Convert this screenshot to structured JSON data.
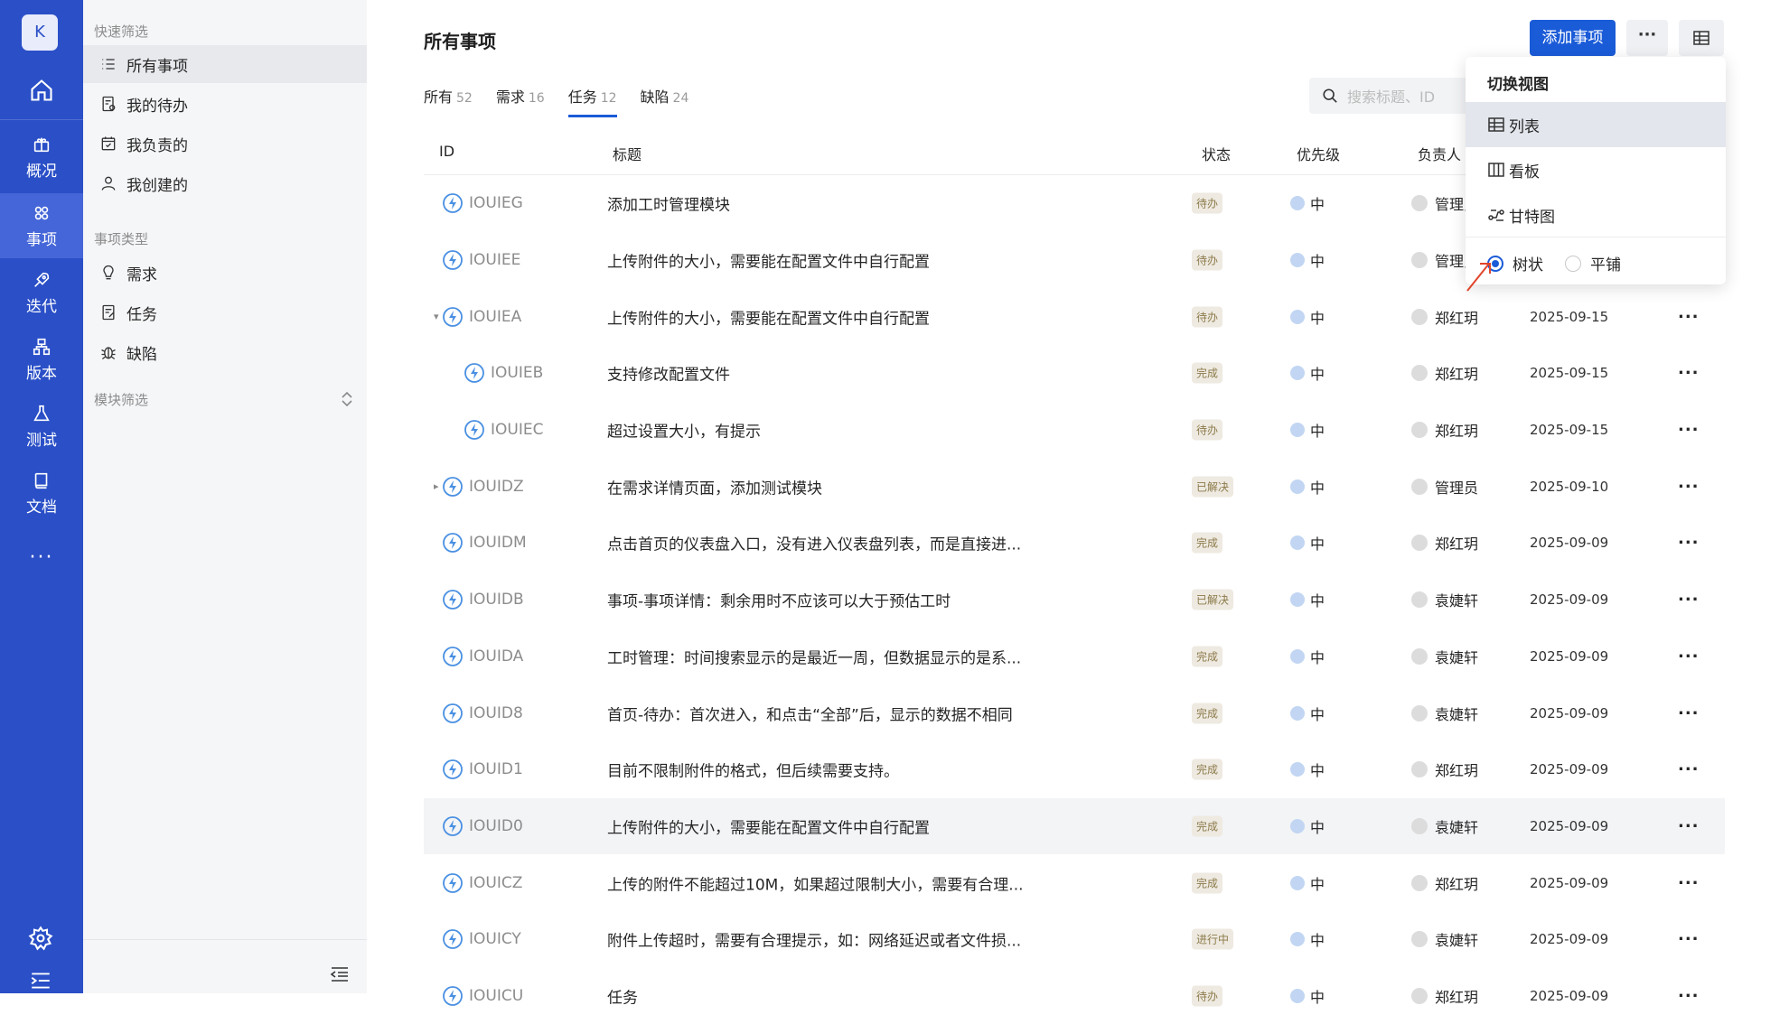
{
  "rail": {
    "avatar_letter": "K",
    "items": [
      {
        "label": "概况"
      },
      {
        "label": "事项"
      },
      {
        "label": "迭代"
      },
      {
        "label": "版本"
      },
      {
        "label": "测试"
      },
      {
        "label": "文档"
      }
    ],
    "more": "···"
  },
  "sidebar": {
    "quick_filter_title": "快速筛选",
    "quick_filters": [
      {
        "label": "所有事项",
        "icon": "list-icon"
      },
      {
        "label": "我的待办",
        "icon": "todo-icon"
      },
      {
        "label": "我负责的",
        "icon": "calendar-check-icon"
      },
      {
        "label": "我创建的",
        "icon": "user-icon"
      }
    ],
    "type_title": "事项类型",
    "types": [
      {
        "label": "需求",
        "icon": "bulb-icon"
      },
      {
        "label": "任务",
        "icon": "task-icon"
      },
      {
        "label": "缺陷",
        "icon": "bug-icon"
      }
    ],
    "module_title": "模块筛选"
  },
  "header": {
    "title": "所有事项",
    "add_button": "添加事项",
    "more_button": "···"
  },
  "tabs": [
    {
      "label": "所有",
      "count": "52"
    },
    {
      "label": "需求",
      "count": "16"
    },
    {
      "label": "任务",
      "count": "12"
    },
    {
      "label": "缺陷",
      "count": "24"
    }
  ],
  "search": {
    "placeholder": "搜索标题、ID"
  },
  "table": {
    "columns": [
      "ID",
      "标题",
      "状态",
      "优先级",
      "负责人"
    ],
    "rows": [
      {
        "id": "IOUIEG",
        "title": "添加工时管理模块",
        "status": "待办",
        "priority": "中",
        "owner": "管理员",
        "date": ""
      },
      {
        "id": "IOUIEE",
        "title": "上传附件的大小，需要能在配置文件中自行配置",
        "status": "待办",
        "priority": "中",
        "owner": "管理员",
        "date": ""
      },
      {
        "id": "IOUIEA",
        "title": "上传附件的大小，需要能在配置文件中自行配置",
        "status": "待办",
        "priority": "中",
        "owner": "郑红玥",
        "date": "2025-09-15"
      },
      {
        "id": "IOUIEB",
        "title": "支持修改配置文件",
        "status": "完成",
        "priority": "中",
        "owner": "郑红玥",
        "date": "2025-09-15"
      },
      {
        "id": "IOUIEC",
        "title": "超过设置大小，有提示",
        "status": "待办",
        "priority": "中",
        "owner": "郑红玥",
        "date": "2025-09-15"
      },
      {
        "id": "IOUIDZ",
        "title": "在需求详情页面，添加测试模块",
        "status": "已解决",
        "priority": "中",
        "owner": "管理员",
        "date": "2025-09-10"
      },
      {
        "id": "IOUIDM",
        "title": "点击首页的仪表盘入口，没有进入仪表盘列表，而是直接进...",
        "status": "完成",
        "priority": "中",
        "owner": "郑红玥",
        "date": "2025-09-09"
      },
      {
        "id": "IOUIDB",
        "title": "事项-事项详情：剩余用时不应该可以大于预估工时",
        "status": "已解决",
        "priority": "中",
        "owner": "袁婕轩",
        "date": "2025-09-09"
      },
      {
        "id": "IOUIDA",
        "title": "工时管理：时间搜索显示的是最近一周，但数据显示的是系...",
        "status": "完成",
        "priority": "中",
        "owner": "袁婕轩",
        "date": "2025-09-09"
      },
      {
        "id": "IOUID8",
        "title": "首页-待办：首次进入，和点击“全部”后，显示的数据不相同",
        "status": "完成",
        "priority": "中",
        "owner": "袁婕轩",
        "date": "2025-09-09"
      },
      {
        "id": "IOUID1",
        "title": "目前不限制附件的格式，但后续需要支持。",
        "status": "完成",
        "priority": "中",
        "owner": "郑红玥",
        "date": "2025-09-09"
      },
      {
        "id": "IOUID0",
        "title": "上传附件的大小，需要能在配置文件中自行配置",
        "status": "完成",
        "priority": "中",
        "owner": "袁婕轩",
        "date": "2025-09-09"
      },
      {
        "id": "IOUICZ",
        "title": "上传的附件不能超过10M，如果超过限制大小，需要有合理...",
        "status": "完成",
        "priority": "中",
        "owner": "郑红玥",
        "date": "2025-09-09"
      },
      {
        "id": "IOUICY",
        "title": "附件上传超时，需要有合理提示，如：网络延迟或者文件损...",
        "status": "进行中",
        "priority": "中",
        "owner": "袁婕轩",
        "date": "2025-09-09"
      },
      {
        "id": "IOUICU",
        "title": "任务",
        "status": "待办",
        "priority": "中",
        "owner": "郑红玥",
        "date": "2025-09-09"
      }
    ]
  },
  "view_menu": {
    "title": "切换视图",
    "options": [
      {
        "label": "列表",
        "icon": "table-icon"
      },
      {
        "label": "看板",
        "icon": "board-icon"
      },
      {
        "label": "甘特图",
        "icon": "gantt-icon"
      }
    ],
    "mode_tree": "树状",
    "mode_flat": "平铺"
  },
  "colors": {
    "rail": "#2a4fc7",
    "accent": "#1a5bd8",
    "arrow": "#e0452b"
  }
}
